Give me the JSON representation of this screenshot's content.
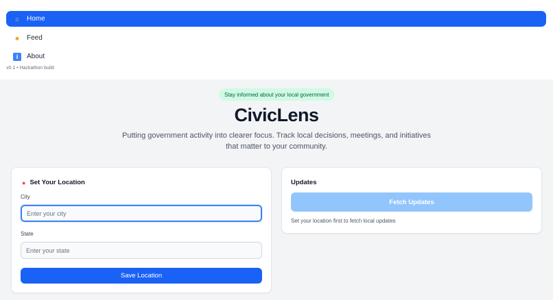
{
  "nav": {
    "items": [
      {
        "label": "Home",
        "icon": "house-icon",
        "active": true
      },
      {
        "label": "Feed",
        "icon": "folder-icon",
        "active": false
      },
      {
        "label": "About",
        "icon": "info-icon",
        "active": false
      }
    ],
    "version": "v0.1 • Hackathon build"
  },
  "hero": {
    "badge": "Stay informed about your local government",
    "title": "CivicLens",
    "subtitle": "Putting government activity into clearer focus. Track local decisions, meetings, and initiatives that matter to your community."
  },
  "location_card": {
    "title": "Set Your Location",
    "city_label": "City",
    "city_placeholder": "Enter your city",
    "city_value": "",
    "state_label": "State",
    "state_placeholder": "Enter your state",
    "state_value": "",
    "save_label": "Save Location"
  },
  "updates_card": {
    "title": "Updates",
    "fetch_label": "Fetch Updates",
    "helper": "Set your location first to fetch local updates"
  },
  "colors": {
    "accent": "#1a62f6",
    "disabled_button": "#93c5fd",
    "badge_bg": "#d1fae5",
    "badge_text": "#065f46"
  }
}
